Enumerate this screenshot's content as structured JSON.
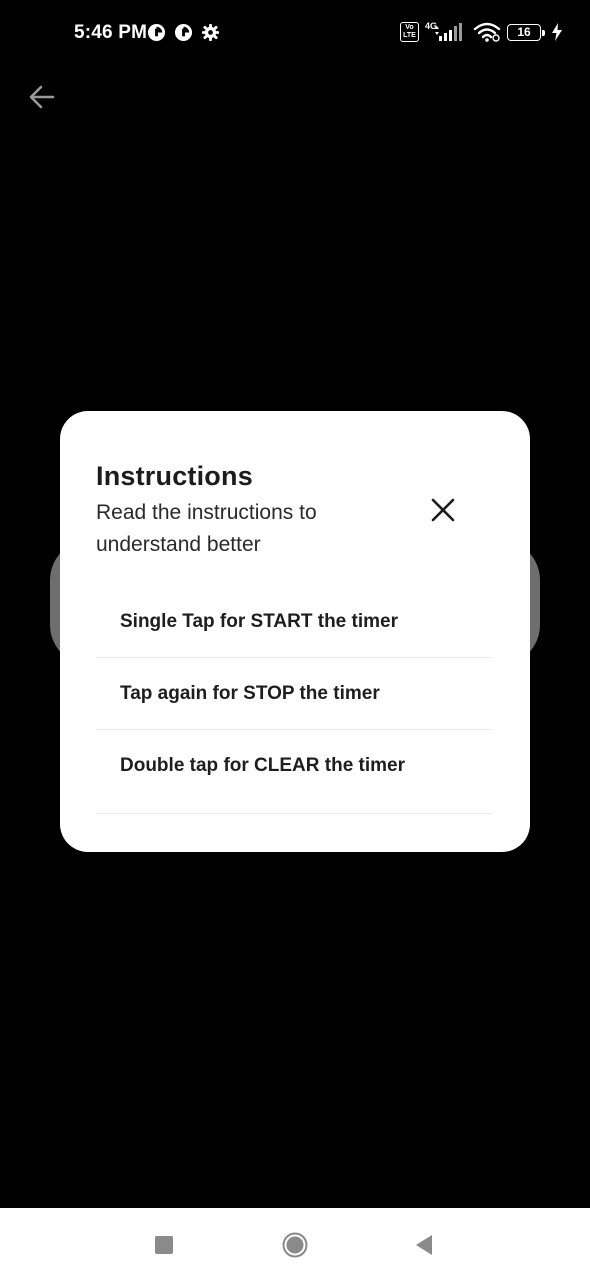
{
  "status_bar": {
    "time": "5:46 PM",
    "volte_top": "Vo",
    "volte_bottom": "LTE",
    "network_type": "4G",
    "battery_level": "16",
    "icons_left": [
      "data-saver-icon",
      "data-saver-icon",
      "settings-gear-icon"
    ],
    "icons_right": [
      "volte-icon",
      "signal-icon",
      "wifi-icon",
      "battery-icon",
      "charging-bolt-icon"
    ]
  },
  "header": {
    "back_icon": "back-arrow-icon"
  },
  "dialog": {
    "title": "Instructions",
    "subtitle": "Read the instructions to understand better",
    "close_icon": "close-icon",
    "items": [
      "Single Tap for START the timer",
      "Tap again for STOP the timer",
      "Double tap for CLEAR the timer"
    ]
  },
  "nav_bar": {
    "icons": [
      "recents-square-icon",
      "home-circle-icon",
      "back-triangle-icon"
    ]
  },
  "colors": {
    "background": "#000000",
    "dialog_bg": "#ffffff",
    "text_primary": "#1c1c1c",
    "divider": "#ececec",
    "pill_gray": "#6e6e6e"
  }
}
